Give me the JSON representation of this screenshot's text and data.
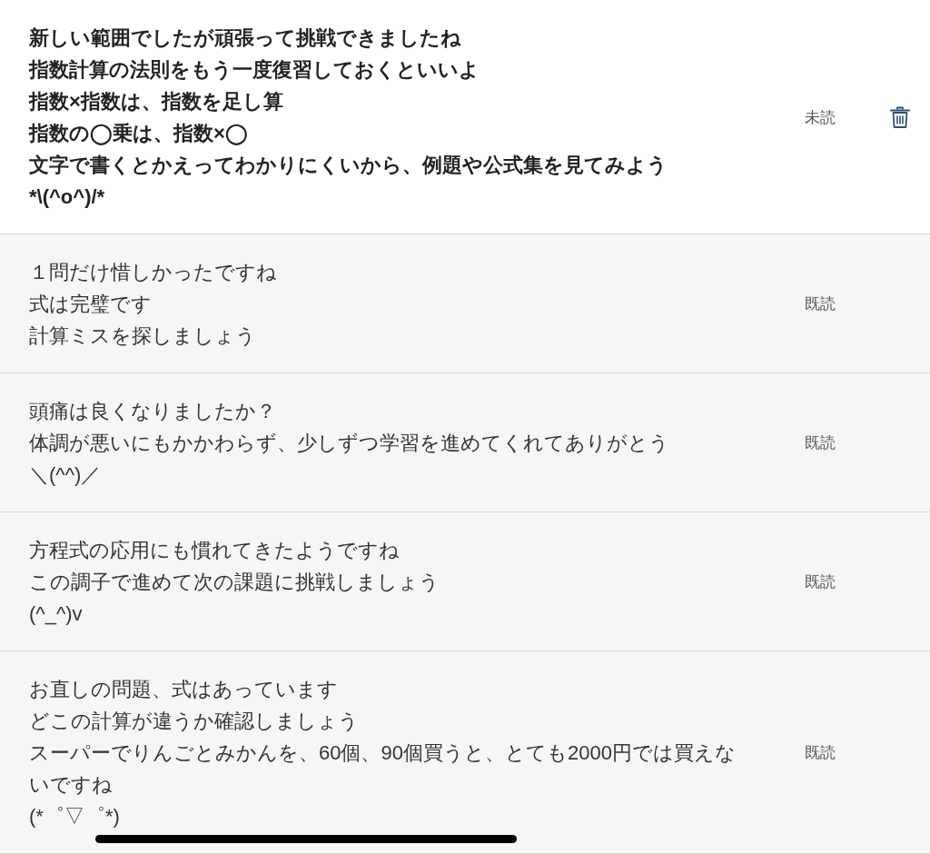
{
  "messages": [
    {
      "read": false,
      "status": "未読",
      "lines": [
        "新しい範囲でしたが頑張って挑戦できましたね",
        "指数計算の法則をもう一度復習しておくといいよ",
        "指数×指数は、指数を足し算",
        "指数の◯乗は、指数×◯",
        "文字で書くとかえってわかりにくいから、例題や公式集を見てみよう",
        "*\\(^o^)/*"
      ]
    },
    {
      "read": true,
      "status": "既読",
      "lines": [
        "１問だけ惜しかったですね",
        "式は完璧です",
        "計算ミスを探しましょう"
      ]
    },
    {
      "read": true,
      "status": "既読",
      "lines": [
        "頭痛は良くなりましたか？",
        "体調が悪いにもかかわらず、少しずつ学習を進めてくれてありがとう",
        "＼(^^)／"
      ]
    },
    {
      "read": true,
      "status": "既読",
      "lines": [
        "方程式の応用にも慣れてきたようですね",
        "この調子で進めて次の課題に挑戦しましょう",
        "(^_^)v"
      ]
    },
    {
      "read": true,
      "status": "既読",
      "lines": [
        "お直しの問題、式はあっています",
        "どこの計算が違うか確認しましょう",
        "スーパーでりんごとみかんを、60個、90個買うと、とても2000円では買えないですね",
        "(*゜▽゜*)"
      ]
    }
  ]
}
